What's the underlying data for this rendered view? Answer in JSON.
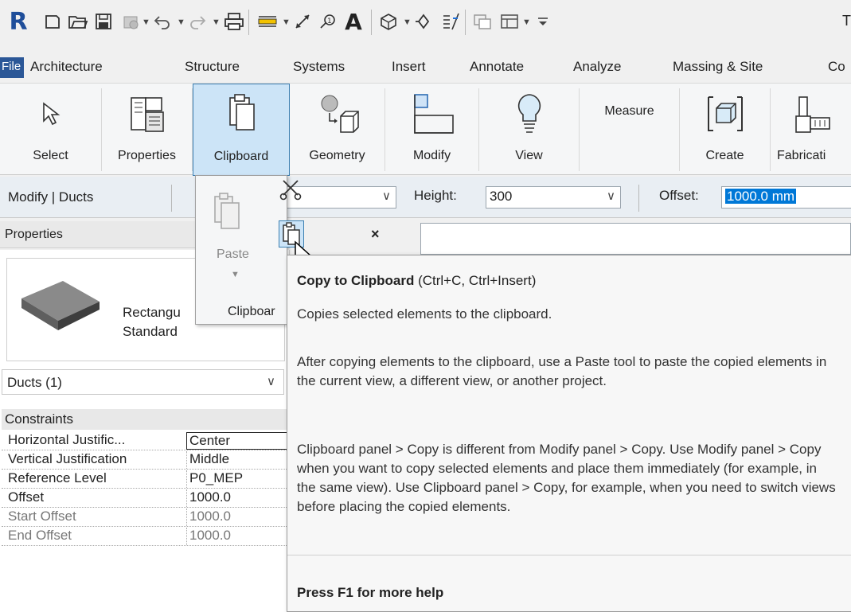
{
  "quick_access": {
    "app_logo": "R",
    "title_fragment": "T",
    "icons": [
      "new-icon",
      "open-icon",
      "save-icon",
      "sync-icon",
      "undo-icon",
      "redo-icon",
      "print-icon",
      "measure-icon",
      "dimension-icon",
      "tag-icon",
      "text-icon",
      "3d-view-icon",
      "section-icon",
      "thin-lines-icon",
      "close-hidden-icon",
      "switch-windows-icon",
      "customize-icon"
    ]
  },
  "tabs": [
    "File",
    "Architecture",
    "Structure",
    "Systems",
    "Insert",
    "Annotate",
    "Analyze",
    "Massing & Site",
    "Co"
  ],
  "ribbon": {
    "select": "Select",
    "properties": "Properties",
    "clipboard": "Clipboard",
    "geometry": "Geometry",
    "modify": "Modify",
    "view": "View",
    "measure": "Measure",
    "create": "Create",
    "fabrication": "Fabricati"
  },
  "options_bar": {
    "context": "Modify | Ducts",
    "height_label": "Height:",
    "height_value": "300",
    "offset_label": "Offset:",
    "offset_value": "1000.0 mm"
  },
  "properties": {
    "header": "Properties",
    "close": "×",
    "type_family": "Rectangu",
    "type_name": "Standard",
    "instance_filter": "Ducts (1)",
    "category": "Constraints",
    "rows": [
      {
        "name": "Horizontal Justific...",
        "value": "Center"
      },
      {
        "name": "Vertical Justification",
        "value": "Middle"
      },
      {
        "name": "Reference Level",
        "value": "P0_MEP"
      },
      {
        "name": "Offset",
        "value": "1000.0"
      },
      {
        "name": "Start Offset",
        "value": "1000.0"
      },
      {
        "name": "End Offset",
        "value": "1000.0"
      }
    ]
  },
  "flyout": {
    "paste": "Paste",
    "panel_label": "Clipboar"
  },
  "tooltip": {
    "title": "Copy to Clipboard",
    "shortcut": "(Ctrl+C, Ctrl+Insert)",
    "p1": "Copies selected elements to the clipboard.",
    "p2": "After copying elements to the clipboard, use a Paste tool to paste the copied elements in the current view, a different view, or another project.",
    "p3": "Clipboard panel > Copy is different from Modify panel > Copy. Use Modify panel > Copy when you want to copy selected elements and place them immediately (for example, in the same view). Use Clipboard panel > Copy, for example, when you need to switch views before placing the copied elements.",
    "help": "Press F1 for more help"
  }
}
